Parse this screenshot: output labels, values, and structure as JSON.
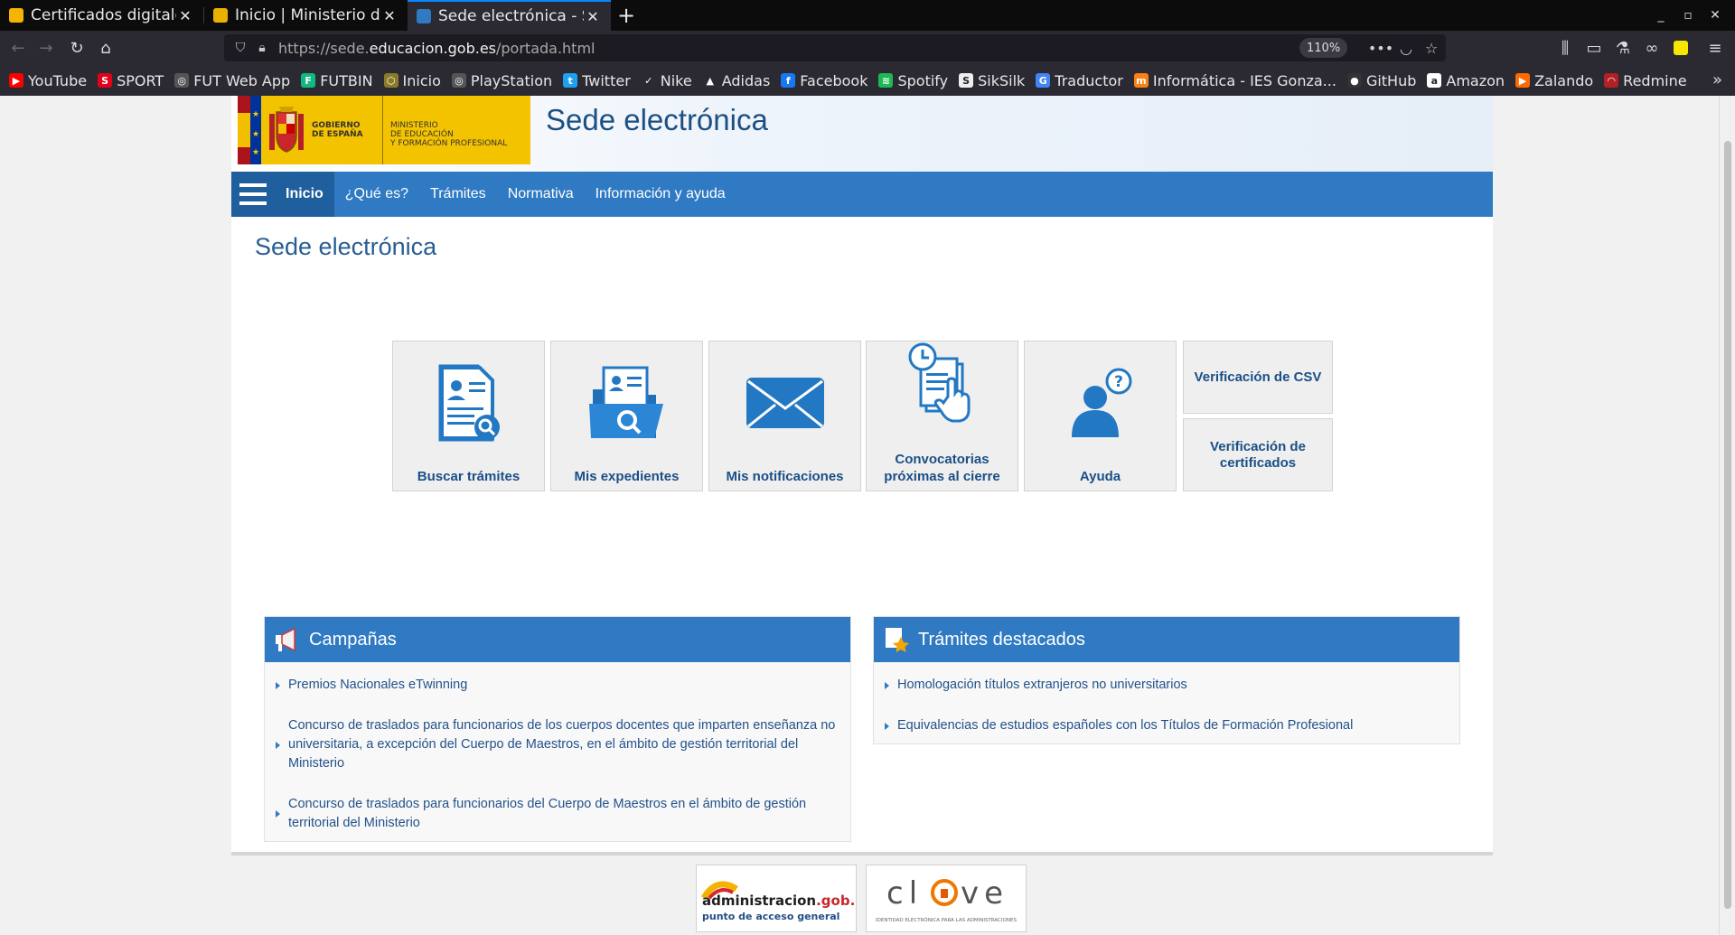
{
  "browser": {
    "tabs": [
      {
        "title": "Certificados digitales",
        "active": false,
        "favicon_color": "#f5b400"
      },
      {
        "title": "Inicio | Ministerio de E",
        "active": false,
        "favicon_color": "#e9b200"
      },
      {
        "title": "Sede electrónica - Sed",
        "active": true,
        "favicon_color": "#2f7ac2"
      }
    ],
    "url_scheme": "https://sede.",
    "url_host": "educacion.gob.es",
    "url_path": "/portada.html",
    "zoom": "110%",
    "bookmarks": [
      {
        "label": "YouTube",
        "color": "#ff0000",
        "glyph": "▶"
      },
      {
        "label": "SPORT",
        "color": "#e3001b",
        "glyph": "S"
      },
      {
        "label": "FUT Web App",
        "color": "#555555",
        "glyph": "◎"
      },
      {
        "label": "FUTBIN",
        "color": "#11b981",
        "glyph": "F"
      },
      {
        "label": "Inicio",
        "color": "#8a7a2a",
        "glyph": "⬡"
      },
      {
        "label": "PlayStation",
        "color": "#555555",
        "glyph": "◎"
      },
      {
        "label": "Twitter",
        "color": "#1da1f2",
        "glyph": "t"
      },
      {
        "label": "Nike",
        "color": "#2b2a33",
        "glyph": "✓"
      },
      {
        "label": "Adidas",
        "color": "#2b2a33",
        "glyph": "▲"
      },
      {
        "label": "Facebook",
        "color": "#1877f2",
        "glyph": "f"
      },
      {
        "label": "Spotify",
        "color": "#1db954",
        "glyph": "≋"
      },
      {
        "label": "SikSilk",
        "color": "#eeeeee",
        "glyph": "S"
      },
      {
        "label": "Traductor",
        "color": "#4285f4",
        "glyph": "G"
      },
      {
        "label": "Informática - IES Gonza...",
        "color": "#f98012",
        "glyph": "m"
      },
      {
        "label": "GitHub",
        "color": "#333333",
        "glyph": "●"
      },
      {
        "label": "Amazon",
        "color": "#ffffff",
        "glyph": "a"
      },
      {
        "label": "Zalando",
        "color": "#ff6900",
        "glyph": "▶"
      },
      {
        "label": "Redmine",
        "color": "#b32024",
        "glyph": "◠"
      }
    ]
  },
  "site": {
    "gobierno": "GOBIERNO\nDE ESPAÑA",
    "ministerio": "MINISTERIO\nDE EDUCACIÓN\nY FORMACIÓN PROFESIONAL",
    "title": "Sede electrónica",
    "nav": [
      "Inicio",
      "¿Qué es?",
      "Trámites",
      "Normativa",
      "Información y ayuda"
    ],
    "heading": "Sede electrónica",
    "tiles": [
      {
        "label": "Buscar trámites",
        "icon": "document-search-icon"
      },
      {
        "label": "Mis expedientes",
        "icon": "folder-search-icon"
      },
      {
        "label": "Mis notificaciones",
        "icon": "envelope-icon"
      },
      {
        "label": "Convocatorias próximas al cierre",
        "icon": "clock-document-hand-icon"
      },
      {
        "label": "Ayuda",
        "icon": "user-help-icon"
      }
    ],
    "small_tiles": [
      "Verificación de CSV",
      "Verificación de certificados"
    ],
    "campaigns": {
      "title": "Campañas",
      "items": [
        "Premios Nacionales eTwinning",
        "Concurso de traslados para funcionarios de los cuerpos docentes que imparten enseñanza no universitaria, a excepción del Cuerpo de Maestros, en el ámbito de gestión territorial del Ministerio",
        "Concurso de traslados para funcionarios del Cuerpo de Maestros en el ámbito de gestión territorial del Ministerio"
      ]
    },
    "featured": {
      "title": "Trámites destacados",
      "items": [
        "Homologación títulos extranjeros no universitarios",
        "Equivalencias de estudios españoles con los Títulos de Formación Profesional"
      ]
    },
    "footer": {
      "admin_logo_main": "administracion",
      "admin_logo_suffix": ".gob.es",
      "admin_logo_sub": "punto de acceso general",
      "clave_logo_left": "cl",
      "clave_logo_right": "ve",
      "clave_logo_sub": "IDENTIDAD ELECTRÓNICA PARA LAS ADMINISTRACIONES"
    },
    "colors": {
      "primary": "#2f7ac2",
      "primary_dark": "#1f5f9e",
      "link": "#23528a",
      "gov_yellow": "#f4c300"
    }
  }
}
